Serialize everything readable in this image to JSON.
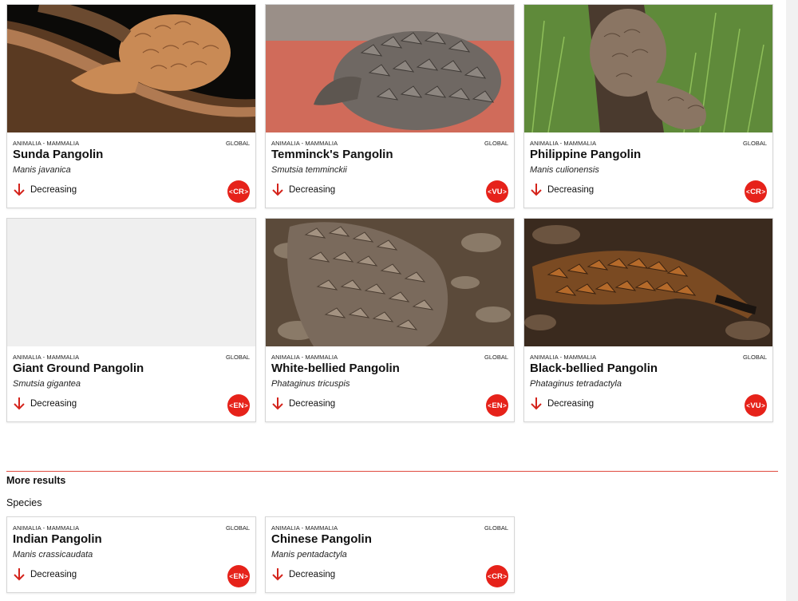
{
  "cards": [
    {
      "kingdom": "ANIMALIA - MAMMALIA",
      "scope": "GLOBAL",
      "name": "Sunda Pangolin",
      "scientific": "Manis javanica",
      "trend": "Decreasing",
      "category": "CR"
    },
    {
      "kingdom": "ANIMALIA - MAMMALIA",
      "scope": "GLOBAL",
      "name": "Temminck's Pangolin",
      "scientific": "Smutsia temminckii",
      "trend": "Decreasing",
      "category": "VU"
    },
    {
      "kingdom": "ANIMALIA - MAMMALIA",
      "scope": "GLOBAL",
      "name": "Philippine Pangolin",
      "scientific": "Manis culionensis",
      "trend": "Decreasing",
      "category": "CR"
    },
    {
      "kingdom": "ANIMALIA - MAMMALIA",
      "scope": "GLOBAL",
      "name": "Giant Ground Pangolin",
      "scientific": "Smutsia gigantea",
      "trend": "Decreasing",
      "category": "EN"
    },
    {
      "kingdom": "ANIMALIA - MAMMALIA",
      "scope": "GLOBAL",
      "name": "White-bellied Pangolin",
      "scientific": "Phataginus tricuspis",
      "trend": "Decreasing",
      "category": "EN"
    },
    {
      "kingdom": "ANIMALIA - MAMMALIA",
      "scope": "GLOBAL",
      "name": "Black-bellied Pangolin",
      "scientific": "Phataginus tetradactyla",
      "trend": "Decreasing",
      "category": "VU"
    }
  ],
  "more_results": {
    "heading": "More results",
    "subheading": "Species",
    "cards": [
      {
        "kingdom": "ANIMALIA - MAMMALIA",
        "scope": "GLOBAL",
        "name": "Indian Pangolin",
        "scientific": "Manis crassicaudata",
        "trend": "Decreasing",
        "category": "EN"
      },
      {
        "kingdom": "ANIMALIA - MAMMALIA",
        "scope": "GLOBAL",
        "name": "Chinese Pangolin",
        "scientific": "Manis pentadactyla",
        "trend": "Decreasing",
        "category": "CR"
      }
    ]
  },
  "colors": {
    "accent": "#e6221a",
    "divider": "#e04a3f"
  },
  "icons": {
    "trend": "arrow-down-icon"
  }
}
